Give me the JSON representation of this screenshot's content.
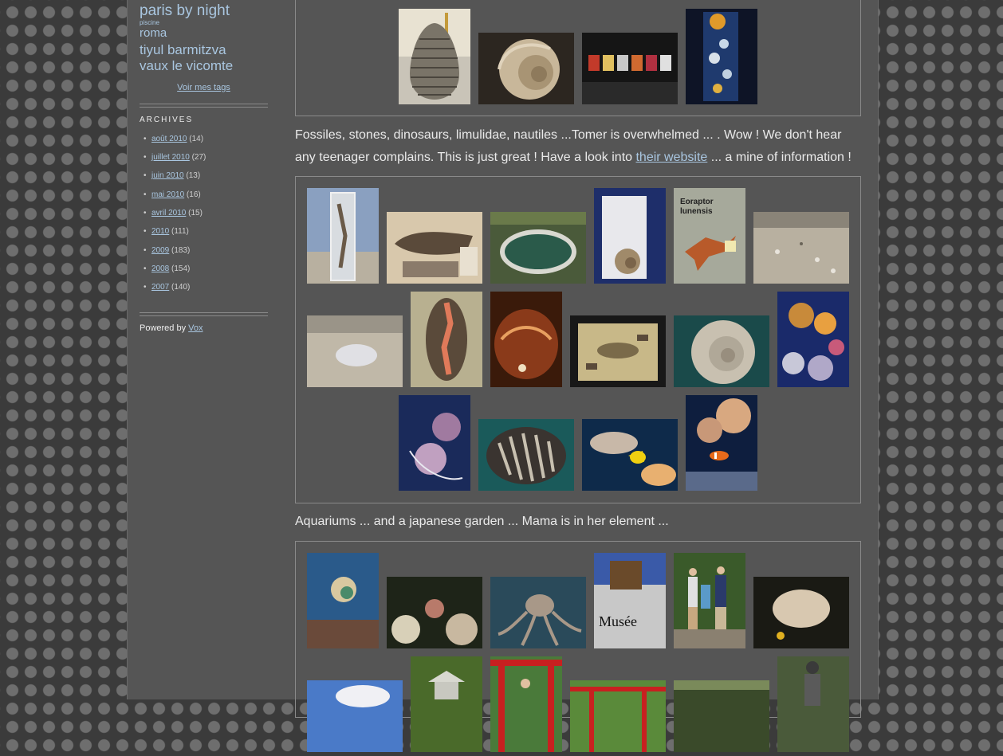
{
  "sidebar": {
    "tags": [
      {
        "label": "paris by night",
        "size": "xl"
      },
      {
        "label": "piscine",
        "size": "xs"
      },
      {
        "label": "roma",
        "size": "lg"
      },
      {
        "label": "tiyul barmitzva",
        "size": "lg"
      },
      {
        "label": "vaux le vicomte",
        "size": "lg"
      }
    ],
    "see_all_tags": "Voir mes tags",
    "archives_title": "ARCHIVES",
    "archives": [
      {
        "label": "août 2010",
        "count": "(14)"
      },
      {
        "label": "juillet 2010",
        "count": "(27)"
      },
      {
        "label": "juin 2010",
        "count": "(13)"
      },
      {
        "label": "mai 2010",
        "count": "(16)"
      },
      {
        "label": "avril 2010",
        "count": "(15)"
      },
      {
        "label": "2010",
        "count": "(111)"
      },
      {
        "label": "2009",
        "count": "(183)"
      },
      {
        "label": "2008",
        "count": "(154)"
      },
      {
        "label": "2007",
        "count": "(140)"
      }
    ],
    "bullet": "•",
    "powered_prefix": "Powered by ",
    "powered_link": "Vox"
  },
  "post": {
    "para1_text": "Fossiles, stones, dinosaurs, limulidae, nautiles ...Tomer is overwhelmed ... . Wow ! We don't hear any teenager complains. This is just great ! Have a look into ",
    "para1_link": "their website",
    "para1_tail": " ... a mine of information !",
    "para2_text": "Aquariums ... and a japanese garden ... Mama is in her element ...",
    "photo_text": {
      "eoraptor": "Eoraptor\nlunensis",
      "musee": "Musée"
    }
  },
  "colors": {
    "page_bg": "#555555",
    "link": "#a9c6e0",
    "body_text": "#eaeaea",
    "border": "#8a8a8a"
  }
}
